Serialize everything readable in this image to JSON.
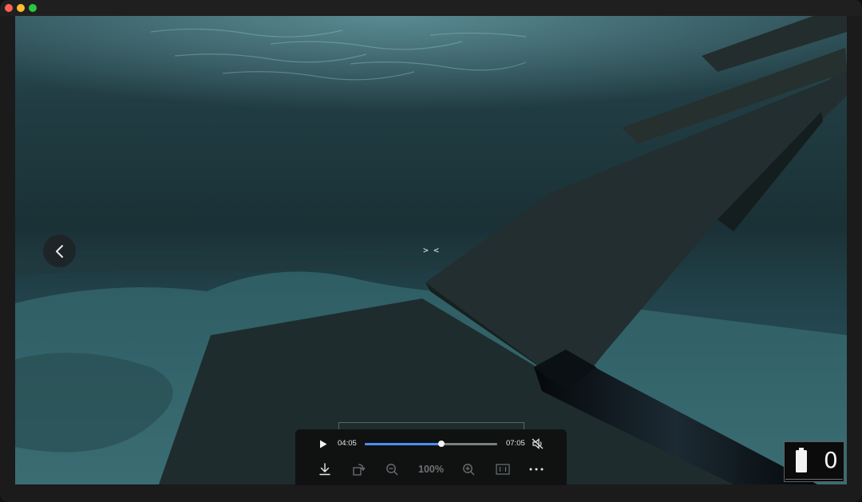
{
  "window": {
    "traffic_lights": [
      "close",
      "minimize",
      "zoom"
    ]
  },
  "hud": {
    "crosshair": "> <",
    "counter": "0"
  },
  "player": {
    "current_time": "04:05",
    "total_time": "07:05",
    "progress": 0.577,
    "zoom_level": "100%",
    "icons": [
      "play-icon",
      "mute-icon",
      "download-icon",
      "rotate-icon",
      "zoom-out-icon",
      "zoom-in-icon",
      "actual-size-icon",
      "more-icon"
    ]
  },
  "colors": {
    "accent": "#4d8df6",
    "water": "#1d3337",
    "panel": "#101212"
  }
}
